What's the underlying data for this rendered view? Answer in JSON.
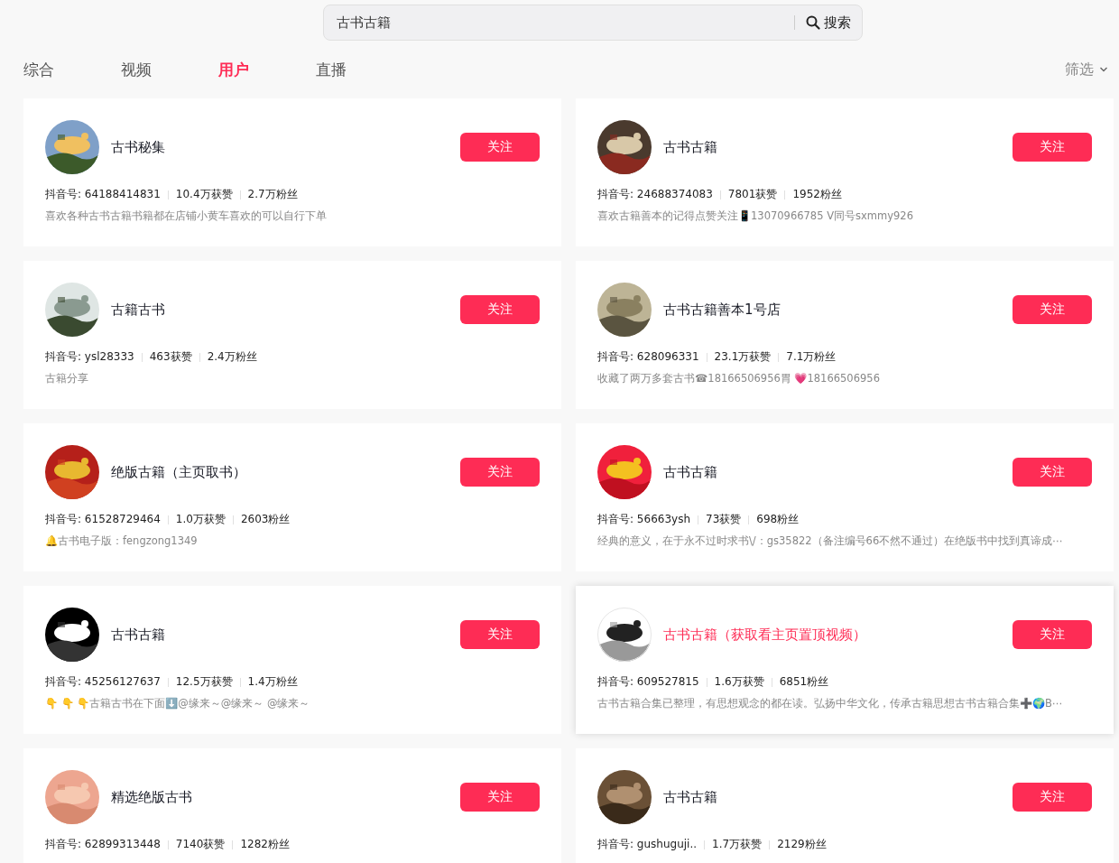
{
  "search": {
    "value": "古书古籍",
    "button": "搜索"
  },
  "tabs": [
    {
      "label": "综合",
      "selected": false
    },
    {
      "label": "视频",
      "selected": false
    },
    {
      "label": "用户",
      "selected": true
    },
    {
      "label": "直播",
      "selected": false
    }
  ],
  "filter": "筛选",
  "users": [
    {
      "name": "古书秘集",
      "id": "抖音号: 64188414831",
      "likes": "10.4万获赞",
      "fans": "2.7万粉丝",
      "bio": "喜欢各种古书古籍书籍都在店铺小黄车喜欢的可以自行下单",
      "follow": "关注",
      "hovered": false
    },
    {
      "name": "古书古籍",
      "id": "抖音号: 24688374083",
      "likes": "7801获赞",
      "fans": "1952粉丝",
      "bio": "喜欢古籍善本的记得点赞关注📱13070966785 V同号sxmmy926",
      "follow": "关注",
      "hovered": false
    },
    {
      "name": "古籍古书",
      "id": "抖音号: ysl28333",
      "likes": "463获赞",
      "fans": "2.4万粉丝",
      "bio": "古籍分享",
      "follow": "关注",
      "hovered": false
    },
    {
      "name": "古书古籍善本1号店",
      "id": "抖音号: 628096331",
      "likes": "23.1万获赞",
      "fans": "7.1万粉丝",
      "bio": "收藏了两万多套古书☎18166506956胃 💗18166506956",
      "follow": "关注",
      "hovered": false
    },
    {
      "name": "绝版古籍（主页取书）",
      "id": "抖音号: 61528729464",
      "likes": "1.0万获赞",
      "fans": "2603粉丝",
      "bio": "🔔古书电子版：fengzong1349",
      "follow": "关注",
      "hovered": false
    },
    {
      "name": "古书古籍",
      "id": "抖音号: 56663ysh",
      "likes": "73获赞",
      "fans": "698粉丝",
      "bio": "经典的意义，在于永不过时求书\\/：gs35822（备注编号66不然不通过）在绝版书中找到真谛成⋯",
      "follow": "关注",
      "hovered": false
    },
    {
      "name": "古书古籍",
      "id": "抖音号: 45256127637",
      "likes": "12.5万获赞",
      "fans": "1.4万粉丝",
      "bio": "👇 👇 👇古籍古书在下面⬇️@缘来～@缘来～ @缘来～",
      "follow": "关注",
      "hovered": false
    },
    {
      "name": "古书古籍（获取看主页置顶视频）",
      "id": "抖音号: 609527815",
      "likes": "1.6万获赞",
      "fans": "6851粉丝",
      "bio": "古书古籍合集已整理，有思想观念的都在读。弘扬中华文化，传承古籍思想古书古籍合集➕🌍B⋯",
      "follow": "关注",
      "hovered": true
    },
    {
      "name": "精选绝版古书",
      "id": "抖音号: 62899313448",
      "likes": "7140获赞",
      "fans": "1282粉丝",
      "follow": "关注",
      "hovered": false
    },
    {
      "name": "古书古籍",
      "id": "抖音号: gushuguji..",
      "likes": "1.7万获赞",
      "fans": "2129粉丝",
      "follow": "关注",
      "hovered": false
    }
  ]
}
